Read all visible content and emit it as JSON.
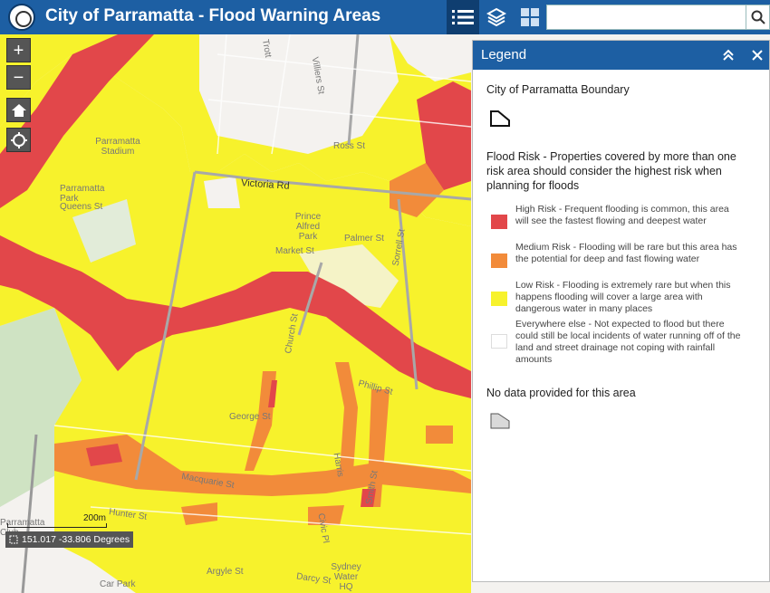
{
  "header": {
    "title": "City of Parramatta - Flood Warning Areas",
    "search_placeholder": ""
  },
  "map": {
    "street_labels": [
      "Victoria Rd",
      "Ross St",
      "Villiers St",
      "Trott",
      "Parramatta Stadium",
      "Parramatta Park",
      "Queens St",
      "Prince Alfred Park",
      "Market St",
      "Palmer St",
      "Sorrell St",
      "George St",
      "Phillip St",
      "Macquarie St",
      "Hunter St",
      "Harris",
      "Smith St",
      "Church St",
      "Civic Pl",
      "Argyle St",
      "Darcy St",
      "Sydney Water HQ",
      "Car Park",
      "Parramatta Club"
    ],
    "scale_label": "200m",
    "coordinates": "151.017 -33.806 Degrees",
    "colors": {
      "high": "#e2474a",
      "medium": "#f28b3a",
      "low": "#f7f22c",
      "base": "#f4f2ef"
    }
  },
  "legend": {
    "title": "Legend",
    "boundary_heading": "City of Parramatta Boundary",
    "flood_heading": "Flood Risk - Properties covered by more than one risk area should consider the highest risk when planning for floods",
    "items": [
      {
        "label": "High Risk - Frequent flooding is common, this area will see the fastest flowing and deepest water",
        "color": "#e2474a"
      },
      {
        "label": "Medium Risk - Flooding will be rare but this area has the potential for deep and fast flowing water",
        "color": "#f28b3a"
      },
      {
        "label": "Low Risk - Flooding is extremely rare but when this happens flooding will cover a large area with dangerous water in many places",
        "color": "#f7f22c"
      },
      {
        "label": "Everywhere else - Not expected to flood but there could still be local incidents of water running off of the land and street drainage not coping with rainfall amounts",
        "color": "#ffffff"
      }
    ],
    "nodata_heading": "No data provided for this area"
  },
  "icons": [
    "list-icon",
    "layers-icon",
    "basemap-grid-icon",
    "search-icon",
    "home-icon",
    "locate-icon",
    "collapse-icon",
    "close-icon"
  ]
}
